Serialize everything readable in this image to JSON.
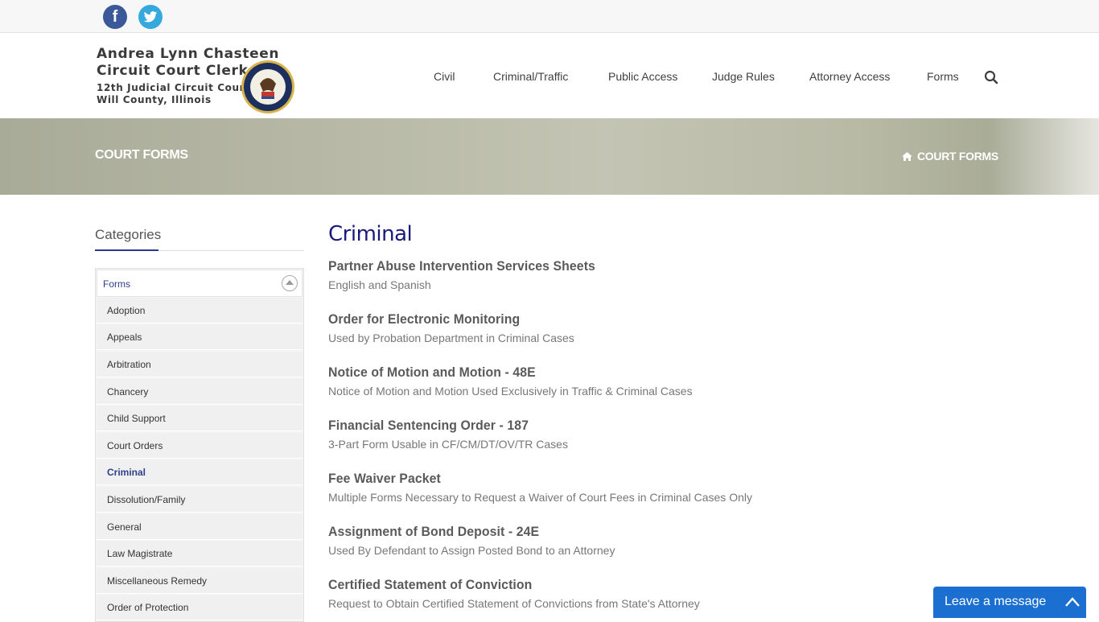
{
  "social": {
    "facebook_glyph": "f",
    "icons": [
      "facebook-icon",
      "twitter-icon"
    ]
  },
  "logo": {
    "line1": "Andrea Lynn Chasteen",
    "line2": "Circuit Court Clerk",
    "line3": "12th Judicial Circuit Court",
    "line4": "Will County, Illinois"
  },
  "nav": {
    "items": [
      {
        "label": "Civil"
      },
      {
        "label": "Criminal/Traffic"
      },
      {
        "label": "Public Access"
      },
      {
        "label": "Judge Rules"
      },
      {
        "label": "Attorney Access"
      },
      {
        "label": "Forms"
      }
    ],
    "search_icon": "search-icon"
  },
  "banner": {
    "title": "COURT FORMS",
    "breadcrumb": "COURT FORMS",
    "breadcrumb_icon": "home-icon"
  },
  "sidebar": {
    "title": "Categories",
    "group": "Forms",
    "items": [
      {
        "label": "Adoption"
      },
      {
        "label": "Appeals"
      },
      {
        "label": "Arbitration"
      },
      {
        "label": "Chancery"
      },
      {
        "label": "Child Support"
      },
      {
        "label": "Court Orders"
      },
      {
        "label": "Criminal",
        "active": true
      },
      {
        "label": "Dissolution/Family"
      },
      {
        "label": "General"
      },
      {
        "label": "Law Magistrate"
      },
      {
        "label": "Miscellaneous Remedy"
      },
      {
        "label": "Order of Protection"
      }
    ]
  },
  "main": {
    "heading": "Criminal",
    "forms": [
      {
        "title": "Partner Abuse Intervention Services Sheets",
        "desc": "English and Spanish"
      },
      {
        "title": "Order for Electronic Monitoring",
        "desc": "Used by Probation Department in Criminal Cases"
      },
      {
        "title": "Notice of Motion and Motion - 48E",
        "desc": "Notice of Motion and Motion Used Exclusively in Traffic & Criminal Cases"
      },
      {
        "title": "Financial Sentencing Order - 187",
        "desc": "3-Part Form Usable in CF/CM/DT/OV/TR Cases"
      },
      {
        "title": "Fee Waiver Packet",
        "desc": "Multiple Forms Necessary to Request a Waiver of Court Fees in Criminal Cases Only"
      },
      {
        "title": "Assignment of Bond Deposit - 24E",
        "desc": "Used By Defendant to Assign Posted Bond to an Attorney"
      },
      {
        "title": "Certified Statement of Conviction",
        "desc": "Request to Obtain Certified Statement of Convictions from State's Attorney"
      }
    ]
  },
  "chat": {
    "label": "Leave a message"
  },
  "colors": {
    "accent": "#2a3b8f",
    "heading": "#1a1a7e",
    "chat": "#1a6fd0",
    "facebook": "#3b5998",
    "twitter": "#35a8de"
  }
}
